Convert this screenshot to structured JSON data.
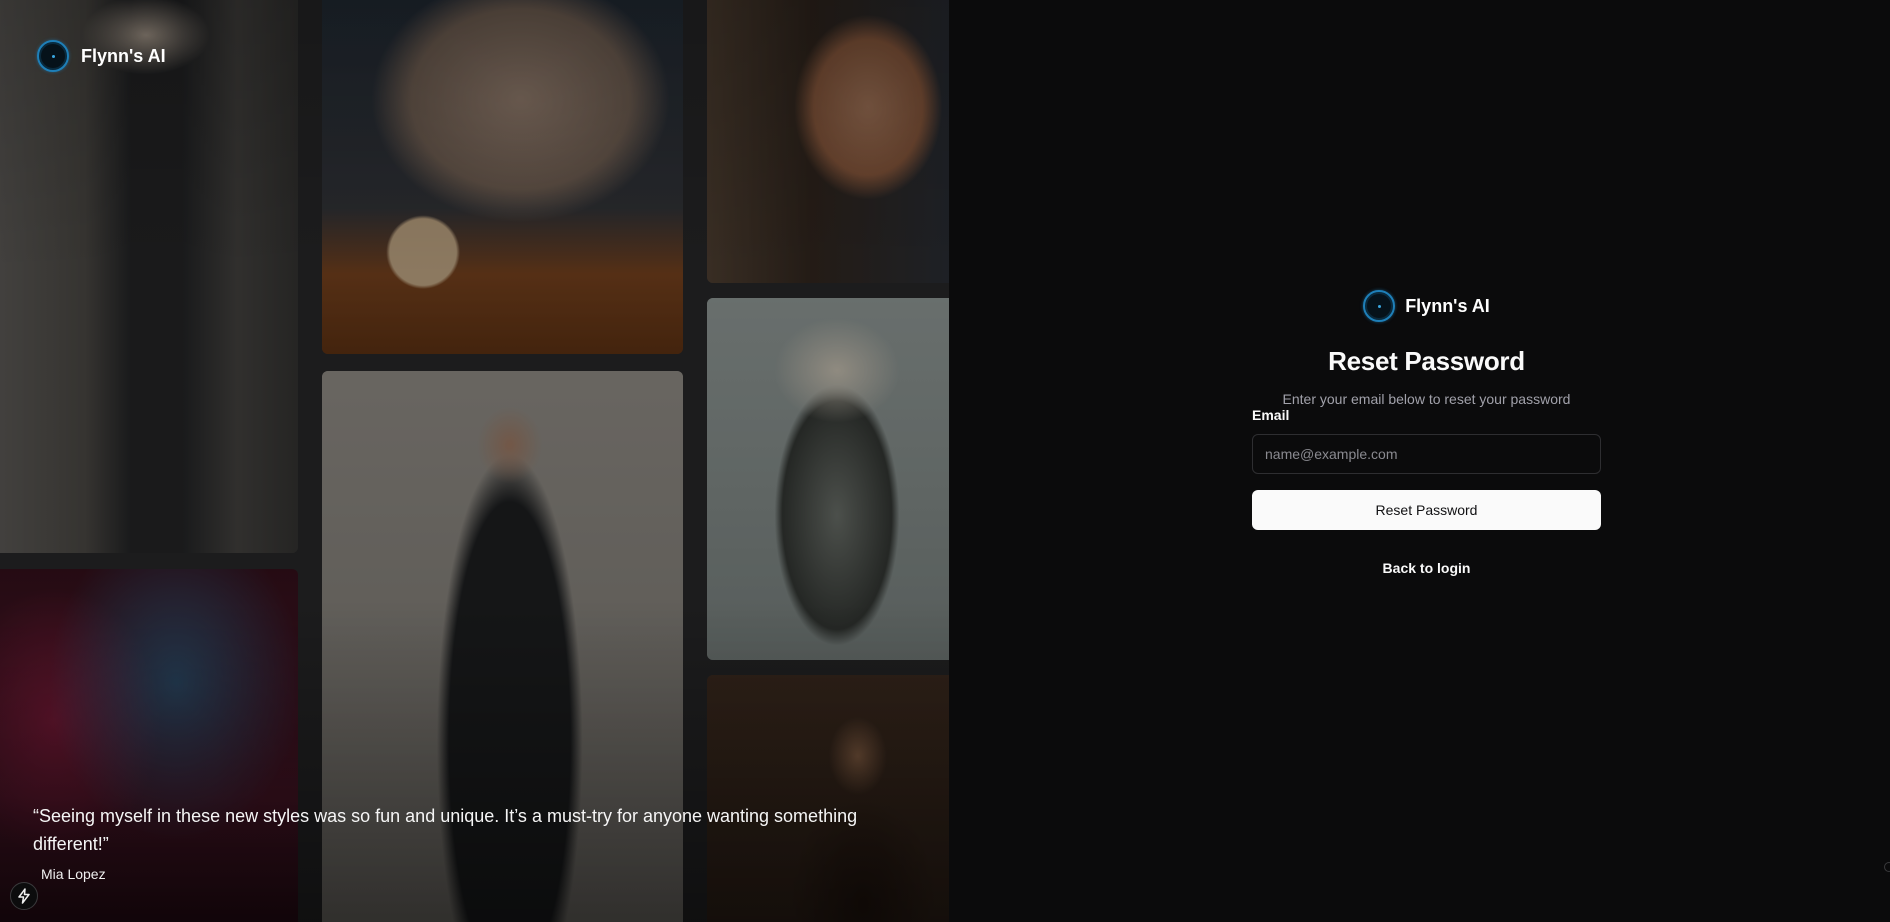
{
  "brand": {
    "name": "Flynn's AI",
    "logo_icon": "ring-logo-icon",
    "accent": "#1e7fb8"
  },
  "testimonial": {
    "quote": "“Seeing myself in these new styles was so fun and unique. It’s a must-try for anyone wanting something different!”",
    "author": "Mia Lopez"
  },
  "gallery": {
    "images": [
      {
        "name": "man-in-black-suit-portrait"
      },
      {
        "name": "woman-sweater-coffee-cup"
      },
      {
        "name": "smiling-man-portrait"
      },
      {
        "name": "man-in-suit-standing"
      },
      {
        "name": "blonde-woman-sci-fi-armor"
      },
      {
        "name": "neon-light-portrait"
      },
      {
        "name": "bearded-man-brown-suit"
      }
    ]
  },
  "form": {
    "title": "Reset Password",
    "subtitle": "Enter your email below to reset your password",
    "email_label": "Email",
    "email_placeholder": "name@example.com",
    "email_value": "",
    "submit_label": "Reset Password",
    "back_link": "Back to login"
  },
  "colors": {
    "background": "#0b0b0c",
    "button_bg": "#fafafa",
    "button_text": "#111113",
    "muted_text": "#a1a1aa"
  },
  "floating_button": {
    "icon": "lightning-bolt-icon"
  }
}
